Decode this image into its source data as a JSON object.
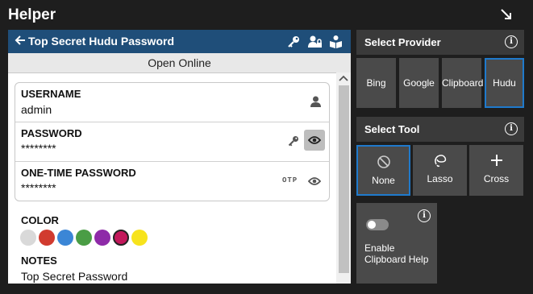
{
  "app": {
    "title": "Helper"
  },
  "hudu": {
    "title": "Top Secret Hudu Password",
    "open_online": "Open Online",
    "fields": [
      {
        "label": "USERNAME",
        "value": "admin"
      },
      {
        "label": "PASSWORD",
        "value": "********"
      },
      {
        "label": "ONE-TIME PASSWORD",
        "value": "********",
        "badge": "OTP"
      }
    ],
    "color_label": "COLOR",
    "colors": [
      "#d9d9d9",
      "#d13b2f",
      "#3b86d6",
      "#4a9d45",
      "#8e2aa8",
      "#c2185b",
      "#f7e31c"
    ],
    "selected_color": "#c2185b",
    "notes_label": "NOTES",
    "notes_value": "Top Secret Password"
  },
  "provider": {
    "header": "Select Provider",
    "options": [
      "Bing",
      "Google",
      "Clipboard",
      "Hudu"
    ],
    "selected": "Hudu"
  },
  "tool": {
    "header": "Select Tool",
    "options": [
      {
        "label": "None",
        "icon": "none-icon"
      },
      {
        "label": "Lasso",
        "icon": "lasso-icon"
      },
      {
        "label": "Cross",
        "icon": "cross-icon"
      }
    ],
    "selected": "None"
  },
  "clipboard": {
    "label": "Enable Clipboard Help",
    "enabled": false
  },
  "accent_color": "#1f7acc",
  "header_color": "#1f4e79"
}
